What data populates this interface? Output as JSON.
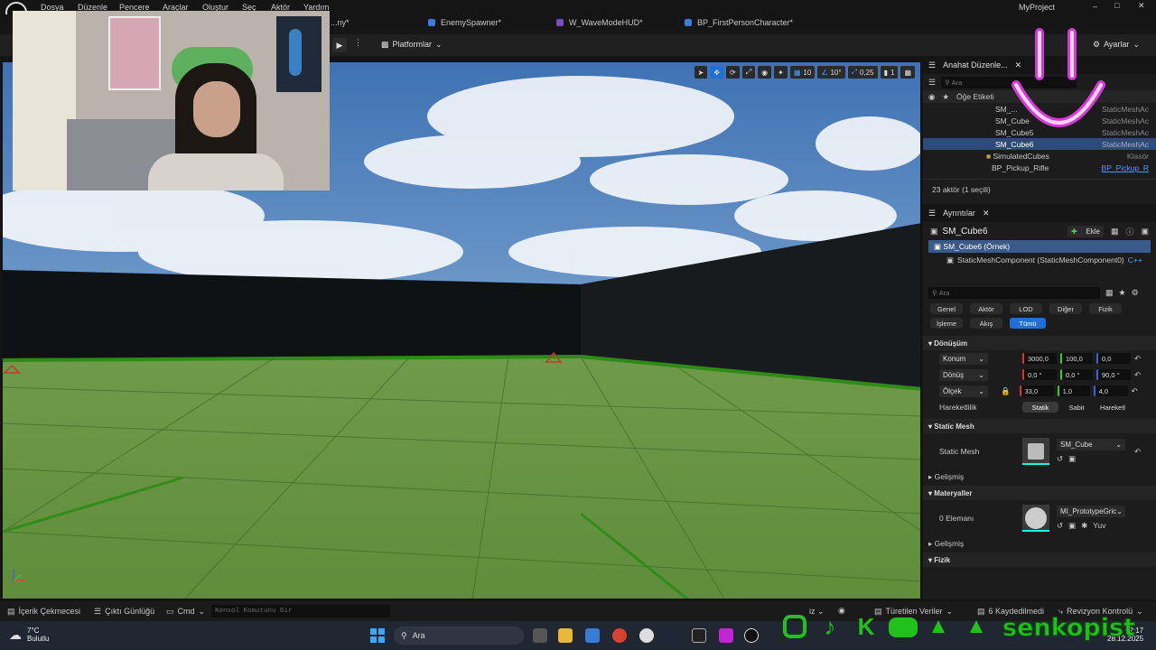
{
  "menu": {
    "items": [
      "Dosya",
      "Düzenle",
      "Pencere",
      "Araçlar",
      "Oluştur",
      "Seç",
      "Aktör",
      "Yardım"
    ],
    "project": "MyProject"
  },
  "tabs": [
    {
      "label": "...ny*"
    },
    {
      "label": "EnemySpawner*"
    },
    {
      "label": "W_WaveModeHUD*"
    },
    {
      "label": "BP_FirstPersonCharacter*"
    }
  ],
  "toolbar": {
    "platforms": "Platformlar",
    "settings": "Ayarlar"
  },
  "viewport_tools": {
    "grid": "10",
    "angle": "10°",
    "scale": "0,25",
    "cam": "1"
  },
  "outliner": {
    "title": "Anahat Düzenle...",
    "search_placeholder": "Ara",
    "col_label": "Öğe Etiketi",
    "rows": [
      {
        "name": "SM_...",
        "type": "StaticMeshAc"
      },
      {
        "name": "SM_Cube",
        "type": "StaticMeshAc"
      },
      {
        "name": "SM_Cube5",
        "type": "StaticMeshAc"
      },
      {
        "name": "SM_Cube6",
        "type": "StaticMeshAc"
      },
      {
        "name": "SimulatedCubes",
        "type": "Klasör"
      },
      {
        "name": "BP_Pickup_Rifle",
        "type": "BP_Pickup_R"
      }
    ],
    "count": "23 aktör (1 seçili)"
  },
  "details": {
    "title": "Ayrıntılar",
    "object": "SM_Cube6",
    "add": "Ekle",
    "instance": "SM_Cube6 (Örnek)",
    "component": "StaticMeshComponent (StaticMeshComponent0)",
    "component_tag": "C++",
    "search_placeholder": "Ara",
    "filters": [
      "Genel",
      "Aktör",
      "LOD",
      "Diğer",
      "Fizik",
      "İşleme",
      "Akış",
      "Tümü"
    ],
    "transform": {
      "header": "Dönüşüm",
      "location": {
        "label": "Konum",
        "x": "3000,0",
        "y": "100,0",
        "z": "0,0"
      },
      "rotation": {
        "label": "Dönüş",
        "x": "0,0 °",
        "y": "0,0 °",
        "z": "90,0 °"
      },
      "scale": {
        "label": "Ölçek",
        "x": "33,0",
        "y": "1,0",
        "z": "4,0"
      },
      "mobility": {
        "label": "Hareketlilik",
        "options": [
          "Statik",
          "Sabit",
          "Hareketl"
        ]
      }
    },
    "static_mesh": {
      "header": "Static Mesh",
      "label": "Static Mesh",
      "value": "SM_Cube",
      "advanced": "Gelişmiş"
    },
    "materials": {
      "header": "Materyaller",
      "label": "0 Elemanı",
      "value": "MI_PrototypeGric",
      "extra": "Yuv",
      "advanced": "Gelişmiş"
    },
    "physics": {
      "header": "Fizik"
    }
  },
  "statusbar": {
    "content_drawer": "İçerik Çekmecesi",
    "output_log": "Çıktı Günlüğü",
    "cmd": "Cmd",
    "console_placeholder": "Konsol Komutunu Gir",
    "derived": "Türetilen Veriler",
    "saved": "6 Kaydedilmedi",
    "revision": "Revizyon Kontrolü"
  },
  "taskbar": {
    "weather_temp": "7°C",
    "weather_desc": "Bulutlu",
    "search": "Ara",
    "time": "12:17",
    "date": "28.12.2025"
  },
  "overlay": {
    "brand": "senkopist"
  }
}
